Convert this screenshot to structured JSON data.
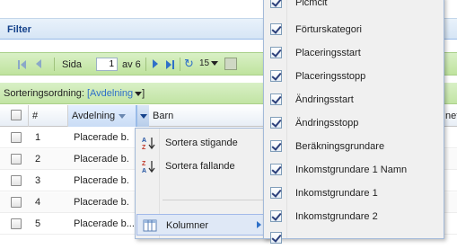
{
  "filter": {
    "title": "Filter"
  },
  "paging": {
    "page_label": "Sida",
    "current_page": "1",
    "of_label": "av 6",
    "page_size": "15",
    "icons": [
      "first-page-icon",
      "prev-page-icon",
      "next-page-icon",
      "last-page-icon",
      "refresh-icon",
      "export-icon"
    ]
  },
  "sort": {
    "label": "Sorteringsordning:",
    "value": "[Avdelning",
    "value_end": "]"
  },
  "grid": {
    "columns": {
      "number": "#",
      "department": "Avdelning",
      "child": "Barn",
      "cut": "net"
    },
    "rows": [
      {
        "n": "1",
        "department": "Placerade b."
      },
      {
        "n": "2",
        "department": "Placerade b."
      },
      {
        "n": "3",
        "department": "Placerade b."
      },
      {
        "n": "4",
        "department": "Placerade b."
      },
      {
        "n": "5",
        "department": "Placerade b..."
      }
    ]
  },
  "column_menu": {
    "sort_asc": "Sortera stigande",
    "sort_desc": "Sortera fallande",
    "columns": "Kolumner"
  },
  "columns_chooser": {
    "items": [
      {
        "label": "Plcmcit",
        "checked": true
      },
      {
        "label": "Förturskategori",
        "checked": true
      },
      {
        "label": "Placeringsstart",
        "checked": true
      },
      {
        "label": "Placeringsstopp",
        "checked": true
      },
      {
        "label": "Ändringsstart",
        "checked": true
      },
      {
        "label": "Ändringsstopp",
        "checked": true
      },
      {
        "label": "Beräkningsgrundare",
        "checked": true
      },
      {
        "label": "Inkomstgrundare 1 Namn",
        "checked": true
      },
      {
        "label": "Inkomstgrundare 1",
        "checked": true
      },
      {
        "label": "Inkomstgrundare 2",
        "checked": true
      },
      {
        "label": "",
        "checked": true
      }
    ]
  },
  "colors": {
    "header_blue": "#15428b",
    "toolbar_green": "#c2e4a4",
    "link_blue": "#2f70c8"
  }
}
